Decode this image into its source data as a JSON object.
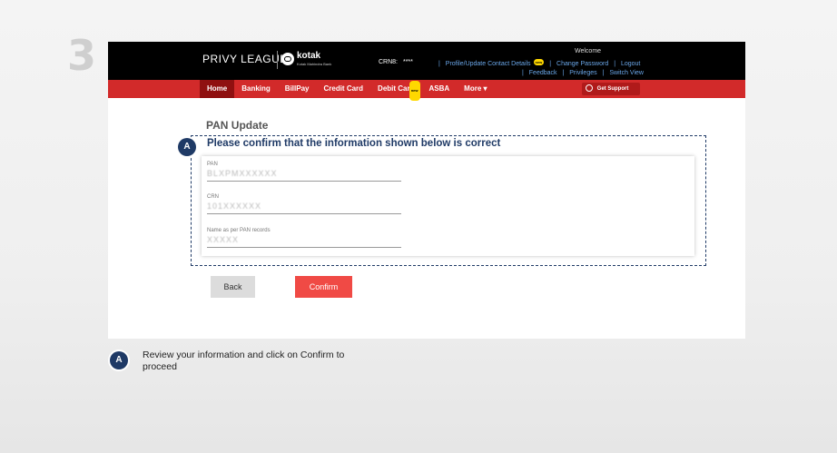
{
  "step_number": "3",
  "header": {
    "brand_text": "PRIVY LEAGUE",
    "bank_name": "kotak",
    "bank_sub": "Kotak Mahindra Bank",
    "crn_label": "CRN8:",
    "crn_value": "****",
    "welcome": "Welcome",
    "links_row1": [
      {
        "label": "Profile/Update Contact Details",
        "badge": "new"
      },
      {
        "label": "Change Password"
      },
      {
        "label": "Logout"
      }
    ],
    "links_row2": [
      {
        "label": "Feedback"
      },
      {
        "label": "Privileges"
      },
      {
        "label": "Switch View"
      }
    ]
  },
  "nav": {
    "tabs": [
      {
        "label": "Home",
        "active": true
      },
      {
        "label": "Banking"
      },
      {
        "label": "BillPay"
      },
      {
        "label": "Credit Card"
      },
      {
        "label": "Debit Card",
        "badge": "new"
      },
      {
        "label": "ASBA"
      },
      {
        "label": "More ▾"
      }
    ],
    "support_label": "Get Support"
  },
  "main": {
    "title": "PAN Update",
    "confirm_heading": "Please confirm that the information shown below is correct",
    "fields": [
      {
        "label": "PAN",
        "value": "BLXPMXXXXXX"
      },
      {
        "label": "CRN",
        "value": "101XXXXXX"
      },
      {
        "label": "Name as per PAN records",
        "value": "XXXXX"
      }
    ],
    "back_label": "Back",
    "confirm_label": "Confirm"
  },
  "annotation": {
    "badge": "A",
    "caption": "Review your information and click on Confirm to proceed"
  },
  "colors": {
    "topbar": "#000000",
    "navbar": "#d22a2a",
    "nav_active": "#8f1010",
    "heading_blue": "#1f3a66",
    "confirm_button": "#f04a45",
    "back_button": "#dcdcdc"
  }
}
